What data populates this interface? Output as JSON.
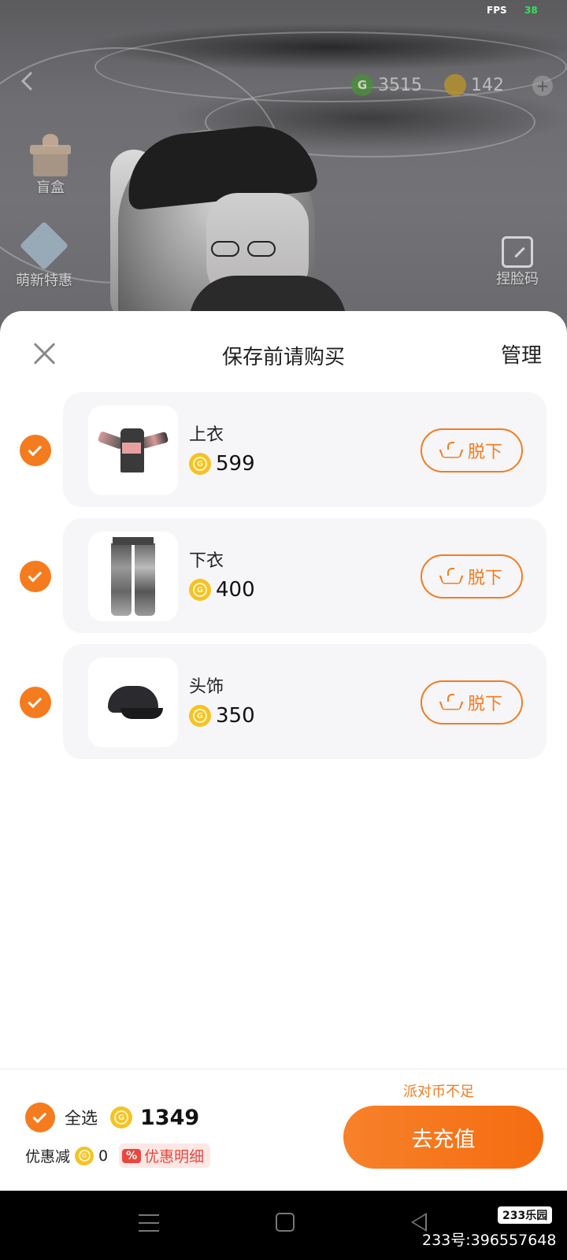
{
  "status": {
    "fps_label": "FPS",
    "fps_value": "38"
  },
  "game": {
    "g_coin": "3515",
    "y_coin": "142",
    "blind_box_label": "盲盒",
    "newbie_label": "萌新特惠",
    "face_code_label": "捏脸码"
  },
  "sheet": {
    "title": "保存前请购买",
    "manage_label": "管理",
    "items": [
      {
        "name": "上衣",
        "price": "599",
        "action": "脱下",
        "checked": true
      },
      {
        "name": "下衣",
        "price": "400",
        "action": "脱下",
        "checked": true
      },
      {
        "name": "头饰",
        "price": "350",
        "action": "脱下",
        "checked": true
      }
    ]
  },
  "footer": {
    "warning": "派对币不足",
    "select_all_label": "全选",
    "total": "1349",
    "discount_label": "优惠减",
    "discount_value": "0",
    "discount_tag": "%",
    "discount_detail": "优惠明细",
    "recharge_label": "去充值"
  },
  "watermark": {
    "logo": "233乐园",
    "id": "233号:396557648"
  },
  "colors": {
    "accent": "#f57b1f",
    "coin": "#f4c325",
    "discount": "#e9473e"
  }
}
